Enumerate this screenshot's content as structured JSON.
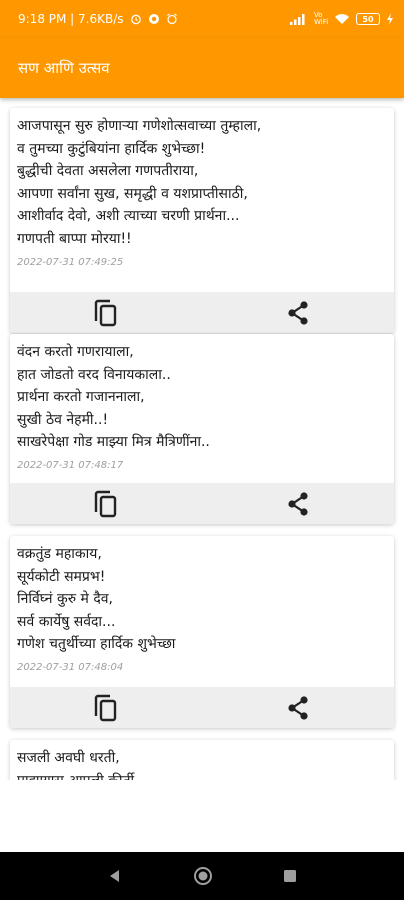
{
  "status_bar": {
    "time_speed": "9:18 PM | 7.6KB/s",
    "network_label": "Vo WiFi",
    "battery": "50",
    "icons": [
      "alarm-icon",
      "circle-app-icon",
      "alarm-clock-icon",
      "signal-icon",
      "wifi-icon",
      "battery-icon",
      "charging-icon"
    ]
  },
  "app_bar": {
    "title": "सण आणि उत्सव"
  },
  "posts": [
    {
      "text": "आजपासून सुरु होणाऱ्या गणेशोत्सवाच्या तुम्हाला,\nव तुमच्या कुटुंबियांना हार्दिक शुभेच्छा!\nबुद्धीची देवता असलेला गणपतीराया,\nआपणा सर्वांना सुख, समृद्धी व यशप्राप्तीसाठी,\nआशीर्वाद देवो, अशी त्याच्या चरणी प्रार्थना...\nगणपती बाप्पा मोरया!!",
      "timestamp": "2022-07-31 07:49:25"
    },
    {
      "text": "वंदन करतो गणरायाला,\nहात जोडतो वरद विनायकाला..\nप्रार्थना करतो गजाननाला,\nसुखी ठेव नेहमी..!\nसाखरेपेक्षा गोड माझ्या मित्र मैत्रिणींना..",
      "timestamp": "2022-07-31 07:48:17"
    },
    {
      "text": "वक्रतुंड महाकाय,\nसूर्यकोटी समप्रभ!\nनिर्विघ्नं कुरु मे दैव,\nसर्व कार्येषु सर्वदा...\nगणेश चतुर्थीच्या हार्दिक शुभेच्छा",
      "timestamp": "2022-07-31 07:48:04"
    },
    {
      "text": "सजली अवघी धरती,\nपाहण्यास आपली कीर्ती",
      "timestamp": ""
    }
  ],
  "colors": {
    "accent": "#ff9800",
    "action_bar": "#eeeeee",
    "timestamp": "#9e9e9e"
  }
}
